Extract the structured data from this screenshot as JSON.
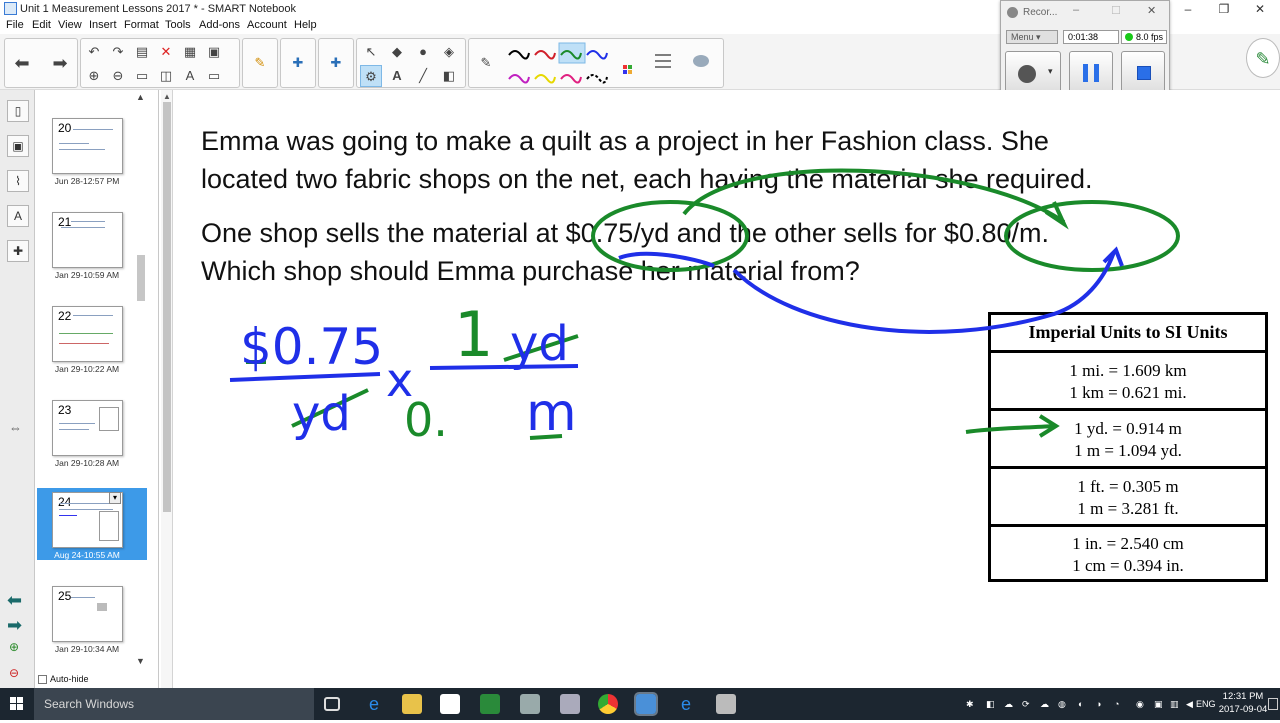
{
  "window": {
    "title": "Unit 1 Measurement Lessons 2017 * - SMART Notebook"
  },
  "menu": [
    "File",
    "Edit",
    "View",
    "Insert",
    "Format",
    "Tools",
    "Add-ons",
    "Account",
    "Help"
  ],
  "recorder": {
    "title": "Recor...",
    "menu_label": "Menu",
    "elapsed": "0:01:38",
    "fps": "8.0 fps"
  },
  "sorter": {
    "pages": [
      {
        "num": "20",
        "date": "Jun 28-12:57 PM"
      },
      {
        "num": "21",
        "date": "Jan 29-10:59 AM"
      },
      {
        "num": "22",
        "date": "Jan 29-10:22 AM"
      },
      {
        "num": "23",
        "date": "Jan 29-10:28 AM"
      },
      {
        "num": "24",
        "date": "Aug 24-10:55 AM"
      },
      {
        "num": "25",
        "date": "Jan 29-10:34 AM"
      }
    ],
    "autohide": "Auto-hide"
  },
  "slide": {
    "line1": "Emma was going to make a quilt as a project in her Fashion class.  She",
    "line2": "located two fabric shops on the net, each having the material she required.",
    "line3": "One shop sells the material at $0.75/yd and the other sells for $0.80/m.",
    "line4": "Which shop should Emma purchase her material from?",
    "table": {
      "title": "Imperial Units to SI Units",
      "rows": [
        [
          "1 mi. = 1.609 km",
          "1 km = 0.621 mi."
        ],
        [
          "1 yd. = 0.914 m",
          "1 m = 1.094 yd."
        ],
        [
          "1 ft. = 0.305 m",
          "1 m = 3.281 ft."
        ],
        [
          "1 in. = 2.540 cm",
          "1 cm = 0.394 in."
        ]
      ]
    },
    "ink": {
      "price": "$0.75",
      "yd_bottom": "yd",
      "times": "x",
      "one": "1",
      "yd_top": "yd",
      "zero": "0.",
      "m": "m"
    },
    "colors": {
      "blue_ink": "#1f2fe8",
      "green_ink": "#1a8a2a"
    }
  },
  "taskbar": {
    "search": "Search Windows",
    "lang": "ENG",
    "time": "12:31 PM",
    "date": "2017-09-04"
  }
}
